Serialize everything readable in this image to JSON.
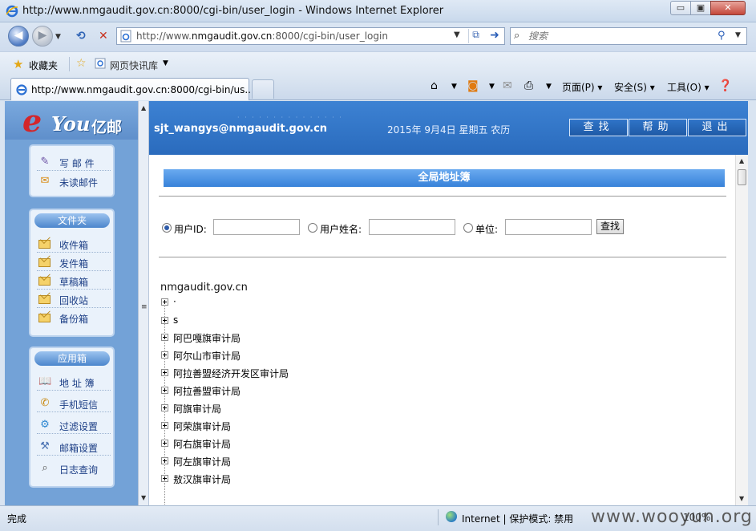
{
  "window": {
    "title": "http://www.nmgaudit.gov.cn:8000/cgi-bin/user_login - Windows Internet Explorer",
    "min_label": "▭",
    "max_label": "▣",
    "close_label": "✕"
  },
  "address": {
    "prefix": "http://www.",
    "host": "nmgaudit.gov.cn",
    "suffix": ":8000/cgi-bin/user_login"
  },
  "search": {
    "placeholder": "搜索"
  },
  "favorites": {
    "label": "收藏夹",
    "quick_label": "网页快讯库"
  },
  "tab": {
    "label": "http://www.nmgaudit.gov.cn:8000/cgi-bin/us..."
  },
  "commands": {
    "page": "页面(P)",
    "safety": "安全(S)",
    "tools": "工具(O)"
  },
  "logo": {
    "e": "e",
    "you": "You",
    "yi": "亿邮"
  },
  "sidebar": {
    "group1": [
      {
        "label": "写 邮 件",
        "icon": "✎"
      },
      {
        "label": "未读邮件",
        "icon": "✉"
      }
    ],
    "folders": {
      "header": "文件夹",
      "items": [
        "收件箱",
        "发件箱",
        "草稿箱",
        "回收站",
        "备份箱"
      ]
    },
    "apps": {
      "header": "应用箱",
      "items": [
        {
          "label": "地 址 簿",
          "icon": "📖"
        },
        {
          "label": "手机短信",
          "icon": "✆"
        },
        {
          "label": "过滤设置",
          "icon": "⚙"
        },
        {
          "label": "邮箱设置",
          "icon": "⚒"
        },
        {
          "label": "日志查询",
          "icon": "⌕"
        }
      ]
    }
  },
  "banner": {
    "user": "sjt_wangys@nmgaudit.gov.cn",
    "date": "2015年 9月4日 星期五 农历",
    "buttons": [
      "查找",
      "帮助",
      "退出"
    ]
  },
  "addressbook": {
    "title": "全局地址簿",
    "options": [
      "用户ID:",
      "用户姓名:",
      "单位:"
    ],
    "selected_option": 0,
    "find_label": "查找",
    "domain": "nmgaudit.gov.cn",
    "nodes": [
      "·",
      "s",
      "阿巴嘎旗审计局",
      "阿尔山市审计局",
      "阿拉善盟经济开发区审计局",
      "阿拉善盟审计局",
      "阿旗审计局",
      "阿荣旗审计局",
      "阿右旗审计局",
      "阿左旗审计局",
      "敖汉旗审计局"
    ]
  },
  "status": {
    "done": "完成",
    "zone": "Internet | 保护模式: 禁用",
    "zoom": "100%",
    "watermark": "www.wooyun.org"
  },
  "colors": {
    "banner": "#2f74c8",
    "sidebar": "#73a2d7",
    "section_title": "#4a90e2"
  }
}
